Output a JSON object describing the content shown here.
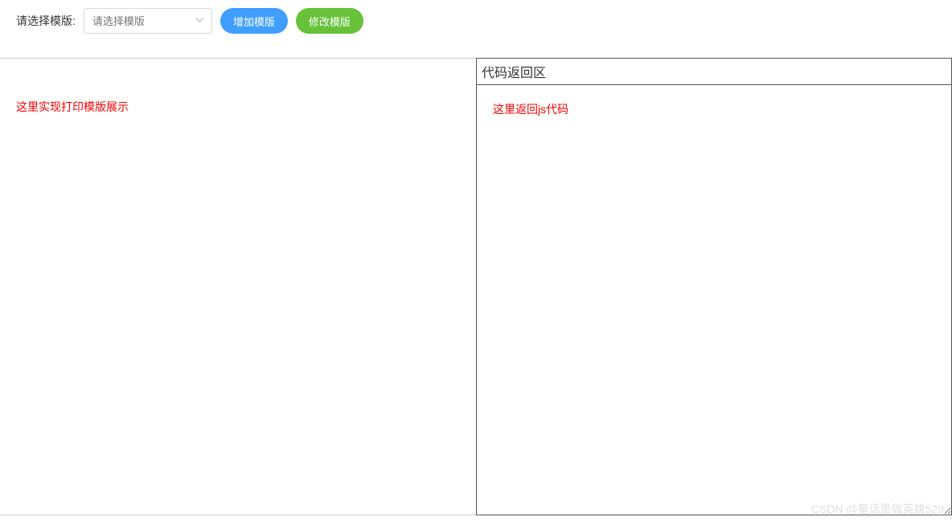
{
  "toolbar": {
    "label": "请选择模版:",
    "select_placeholder": "请选择模版",
    "add_button": "增加模版",
    "modify_button": "修改模版"
  },
  "left_panel": {
    "text": "这里实现打印模版展示"
  },
  "right_panel": {
    "header": "代码返回区",
    "text": "这里返回js代码"
  },
  "watermark": "CSDN @童话里做英雄529"
}
